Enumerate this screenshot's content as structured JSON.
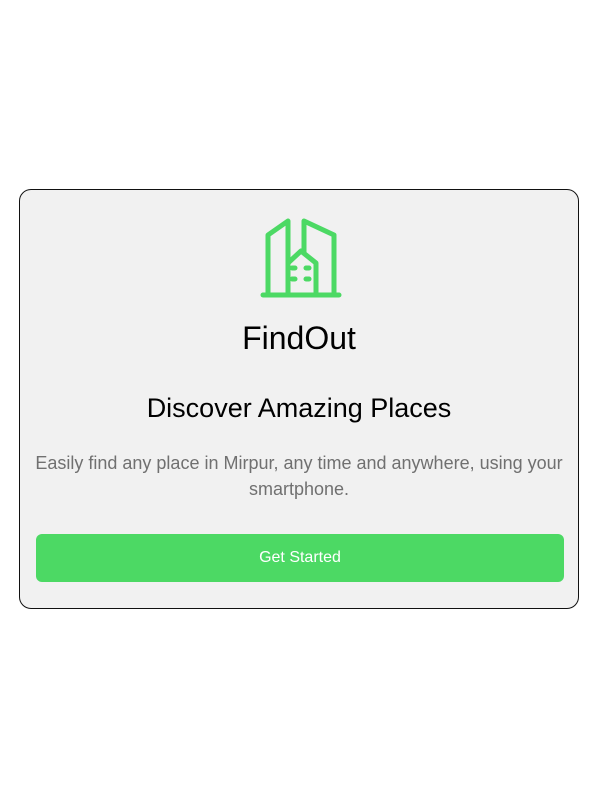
{
  "app": {
    "name": "FindOut",
    "logo_icon": "building-icon"
  },
  "hero": {
    "headline": "Discover Amazing Places",
    "description": "Easily find any place in Mirpur, any time and anywhere, using your smartphone."
  },
  "cta": {
    "label": "Get Started"
  },
  "colors": {
    "accent": "#4cd964",
    "card_background": "#f1f1f1",
    "description_text": "#707070"
  }
}
